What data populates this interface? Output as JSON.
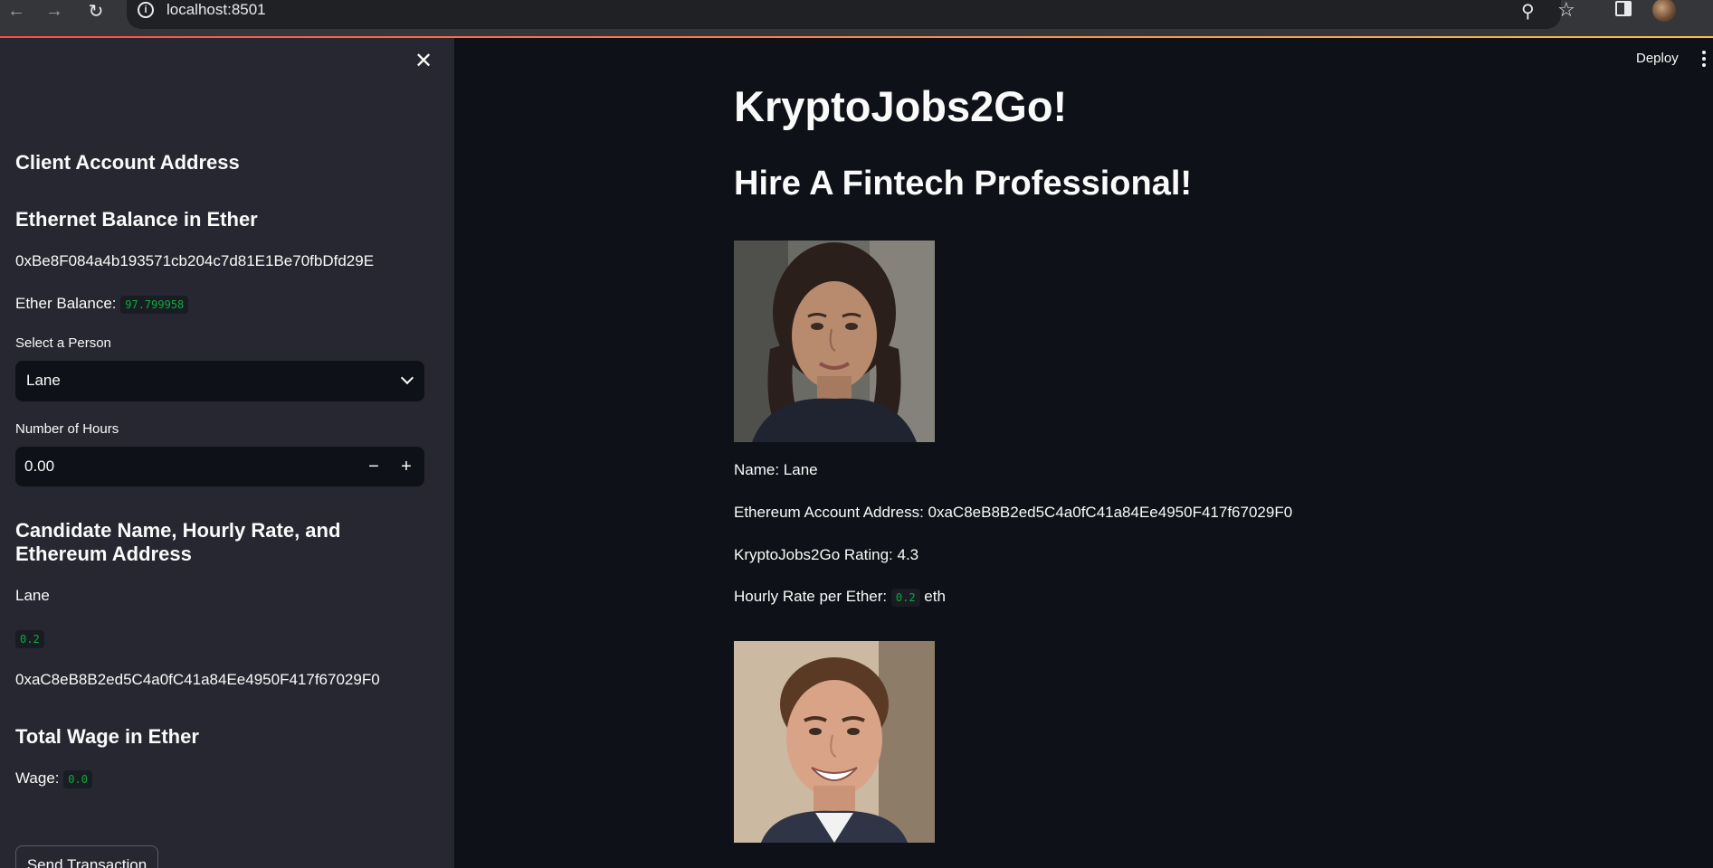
{
  "browser": {
    "url": "localhost:8501"
  },
  "sidebar": {
    "client_heading": "Client Account Address",
    "balance_heading": "Ethernet Balance in Ether",
    "address": "0xBe8F084a4b193571cb204c7d81E1Be70fbDfd29E",
    "ether_balance_label": "Ether Balance:",
    "ether_balance_value": "97.799958",
    "select_label": "Select a Person",
    "select_value": "Lane",
    "hours_label": "Number of Hours",
    "hours_value": "0.00",
    "candidate_heading": "Candidate Name, Hourly Rate, and Ethereum Address",
    "candidate_name": "Lane",
    "candidate_rate": "0.2",
    "candidate_address": "0xaC8eB8B2ed5C4a0fC41a84Ee4950F417f67029F0",
    "wage_heading": "Total Wage in Ether",
    "wage_label": "Wage:",
    "wage_value": "0.0",
    "send_button": "Send Transaction"
  },
  "header": {
    "deploy_label": "Deploy"
  },
  "main": {
    "title": "KryptoJobs2Go!",
    "subtitle": "Hire A Fintech Professional!",
    "candidates": [
      {
        "name_text": "Name: Lane",
        "address_text": "Ethereum Account Address: 0xaC8eB8B2ed5C4a0fC41a84Ee4950F417f67029F0",
        "rating_text": "KryptoJobs2Go Rating: 4.3",
        "rate_label": "Hourly Rate per Ether:",
        "rate_value": "0.2",
        "rate_unit": "eth"
      }
    ]
  },
  "colors": {
    "app_bg": "#0e1117",
    "sidebar_bg": "#262730",
    "code_text": "#09ab3b",
    "accent_start": "#ff4b4b",
    "accent_end": "#ffbd45"
  }
}
